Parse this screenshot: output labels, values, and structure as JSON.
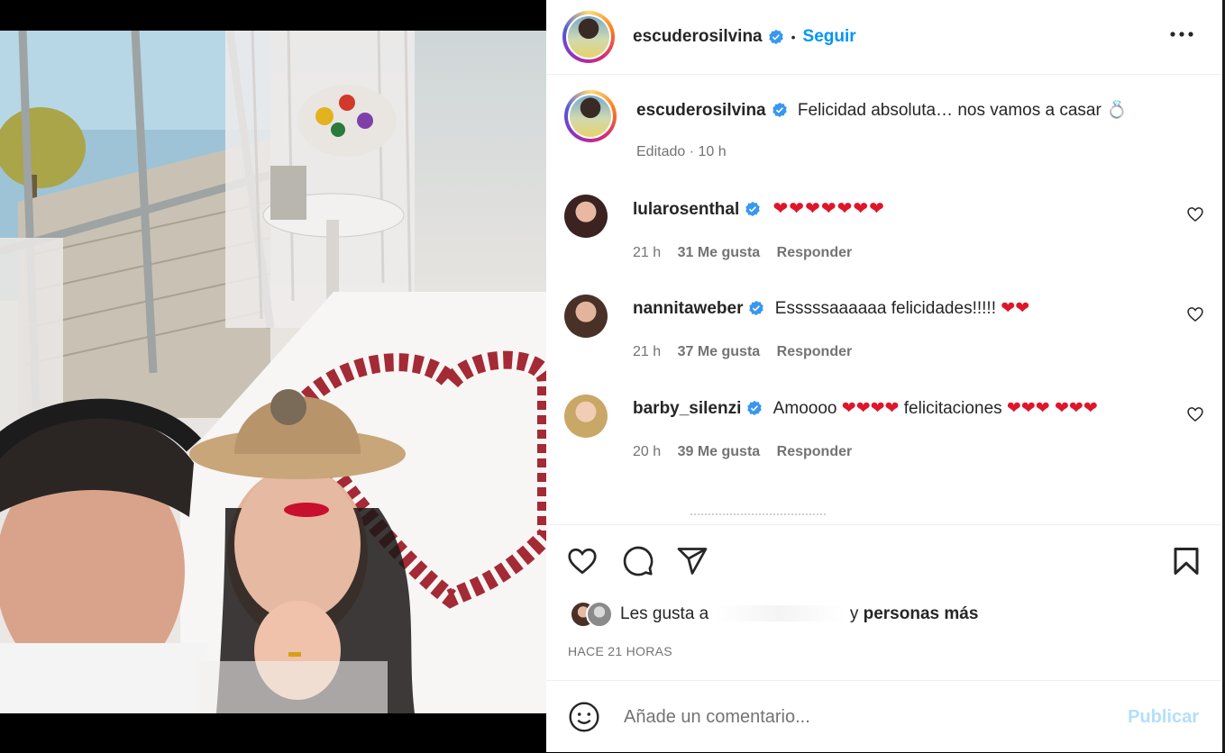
{
  "post": {
    "author": "escuderosilvina",
    "follow_label": "Seguir",
    "separator": "•",
    "caption": "Felicidad absoluta… nos vamos a casar 💍",
    "caption_meta": "Editado · 10 h"
  },
  "comments": [
    {
      "username": "lularosenthal",
      "text": "❤❤❤❤❤❤❤",
      "time": "21 h",
      "likes": "31 Me gusta",
      "reply": "Responder"
    },
    {
      "username": "nannitaweber",
      "text": "Esssssaaaaaa felicidades!!!!! ❤❤",
      "time": "21 h",
      "likes": "37 Me gusta",
      "reply": "Responder"
    },
    {
      "username": "barby_silenzi",
      "text": "Amoooo ❤❤❤❤ felicitaciones ❤❤❤ ❤❤❤",
      "time": "20 h",
      "likes": "39 Me gusta",
      "reply": "Responder"
    }
  ],
  "likes": {
    "prefix": "Les gusta a",
    "middle": "y",
    "suffix": "personas más"
  },
  "time_ago": "HACE 21 HORAS",
  "add_comment": {
    "placeholder": "Añade un comentario...",
    "publish_label": "Publicar"
  },
  "icons": [
    "verified-badge-icon",
    "more-options-icon",
    "heart-icon",
    "comment-icon",
    "share-icon",
    "bookmark-icon",
    "emoji-icon"
  ],
  "colors": {
    "accent": "#0095f6",
    "publish_disabled": "#b2dffc",
    "heart_red": "#e0152a"
  }
}
